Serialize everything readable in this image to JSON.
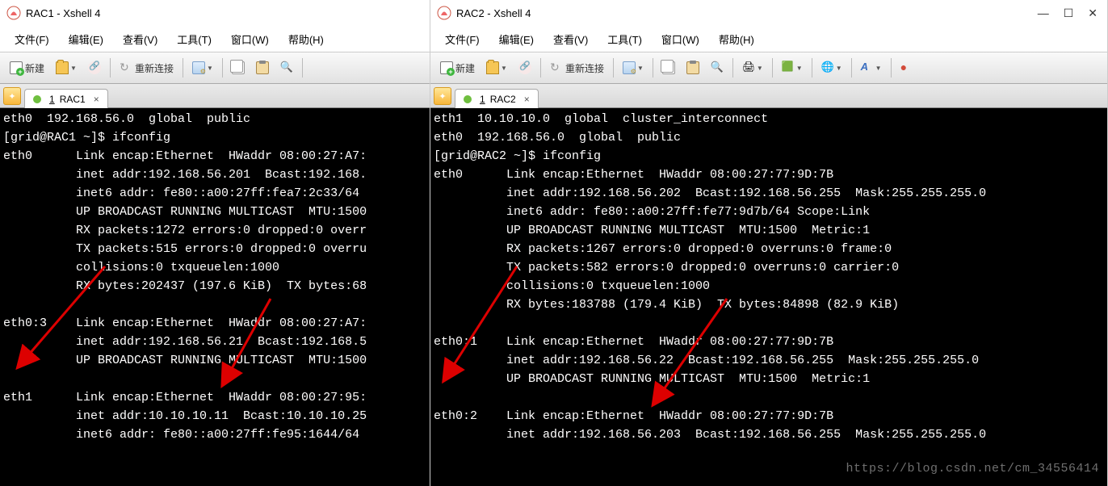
{
  "panes": [
    {
      "key": "left",
      "title": "RAC1 - Xshell 4",
      "show_win_ctrls": false,
      "menus": [
        {
          "k": "file",
          "label": "文件(F)"
        },
        {
          "k": "edit",
          "label": "编辑(E)"
        },
        {
          "k": "view",
          "label": "查看(V)"
        },
        {
          "k": "tool",
          "label": "工具(T)"
        },
        {
          "k": "window",
          "label": "窗口(W)"
        },
        {
          "k": "help",
          "label": "帮助(H)"
        }
      ],
      "toolbar": {
        "new_label": "新建",
        "reconnect_label": "重新连接"
      },
      "tab": {
        "number": "1",
        "name": "RAC1"
      },
      "terminal": "eth0  192.168.56.0  global  public\n[grid@RAC1 ~]$ ifconfig\neth0      Link encap:Ethernet  HWaddr 08:00:27:A7:\n          inet addr:192.168.56.201  Bcast:192.168.\n          inet6 addr: fe80::a00:27ff:fea7:2c33/64 \n          UP BROADCAST RUNNING MULTICAST  MTU:1500\n          RX packets:1272 errors:0 dropped:0 overr\n          TX packets:515 errors:0 dropped:0 overru\n          collisions:0 txqueuelen:1000\n          RX bytes:202437 (197.6 KiB)  TX bytes:68\n\neth0:3    Link encap:Ethernet  HWaddr 08:00:27:A7:\n          inet addr:192.168.56.21  Bcast:192.168.5\n          UP BROADCAST RUNNING MULTICAST  MTU:1500\n\neth1      Link encap:Ethernet  HWaddr 08:00:27:95:\n          inet addr:10.10.10.11  Bcast:10.10.10.25\n          inet6 addr: fe80::a00:27ff:fe95:1644/64 "
    },
    {
      "key": "right",
      "title": "RAC2 - Xshell 4",
      "show_win_ctrls": true,
      "menus": [
        {
          "k": "file",
          "label": "文件(F)"
        },
        {
          "k": "edit",
          "label": "编辑(E)"
        },
        {
          "k": "view",
          "label": "查看(V)"
        },
        {
          "k": "tool",
          "label": "工具(T)"
        },
        {
          "k": "window",
          "label": "窗口(W)"
        },
        {
          "k": "help",
          "label": "帮助(H)"
        }
      ],
      "toolbar": {
        "new_label": "新建",
        "reconnect_label": "重新连接"
      },
      "tab": {
        "number": "1",
        "name": "RAC2"
      },
      "terminal": "eth1  10.10.10.0  global  cluster_interconnect\neth0  192.168.56.0  global  public\n[grid@RAC2 ~]$ ifconfig\neth0      Link encap:Ethernet  HWaddr 08:00:27:77:9D:7B\n          inet addr:192.168.56.202  Bcast:192.168.56.255  Mask:255.255.255.0\n          inet6 addr: fe80::a00:27ff:fe77:9d7b/64 Scope:Link\n          UP BROADCAST RUNNING MULTICAST  MTU:1500  Metric:1\n          RX packets:1267 errors:0 dropped:0 overruns:0 frame:0\n          TX packets:582 errors:0 dropped:0 overruns:0 carrier:0\n          collisions:0 txqueuelen:1000\n          RX bytes:183788 (179.4 KiB)  TX bytes:84898 (82.9 KiB)\n\neth0:1    Link encap:Ethernet  HWaddr 08:00:27:77:9D:7B\n          inet addr:192.168.56.22  Bcast:192.168.56.255  Mask:255.255.255.0\n          UP BROADCAST RUNNING MULTICAST  MTU:1500  Metric:1\n\neth0:2    Link encap:Ethernet  HWaddr 08:00:27:77:9D:7B\n          inet addr:192.168.56.203  Bcast:192.168.56.255  Mask:255.255.255.0",
      "watermark": "https://blog.csdn.net/cm_34556414"
    }
  ],
  "win_ctrls": {
    "min": "—",
    "max": "☐",
    "close": "✕"
  }
}
